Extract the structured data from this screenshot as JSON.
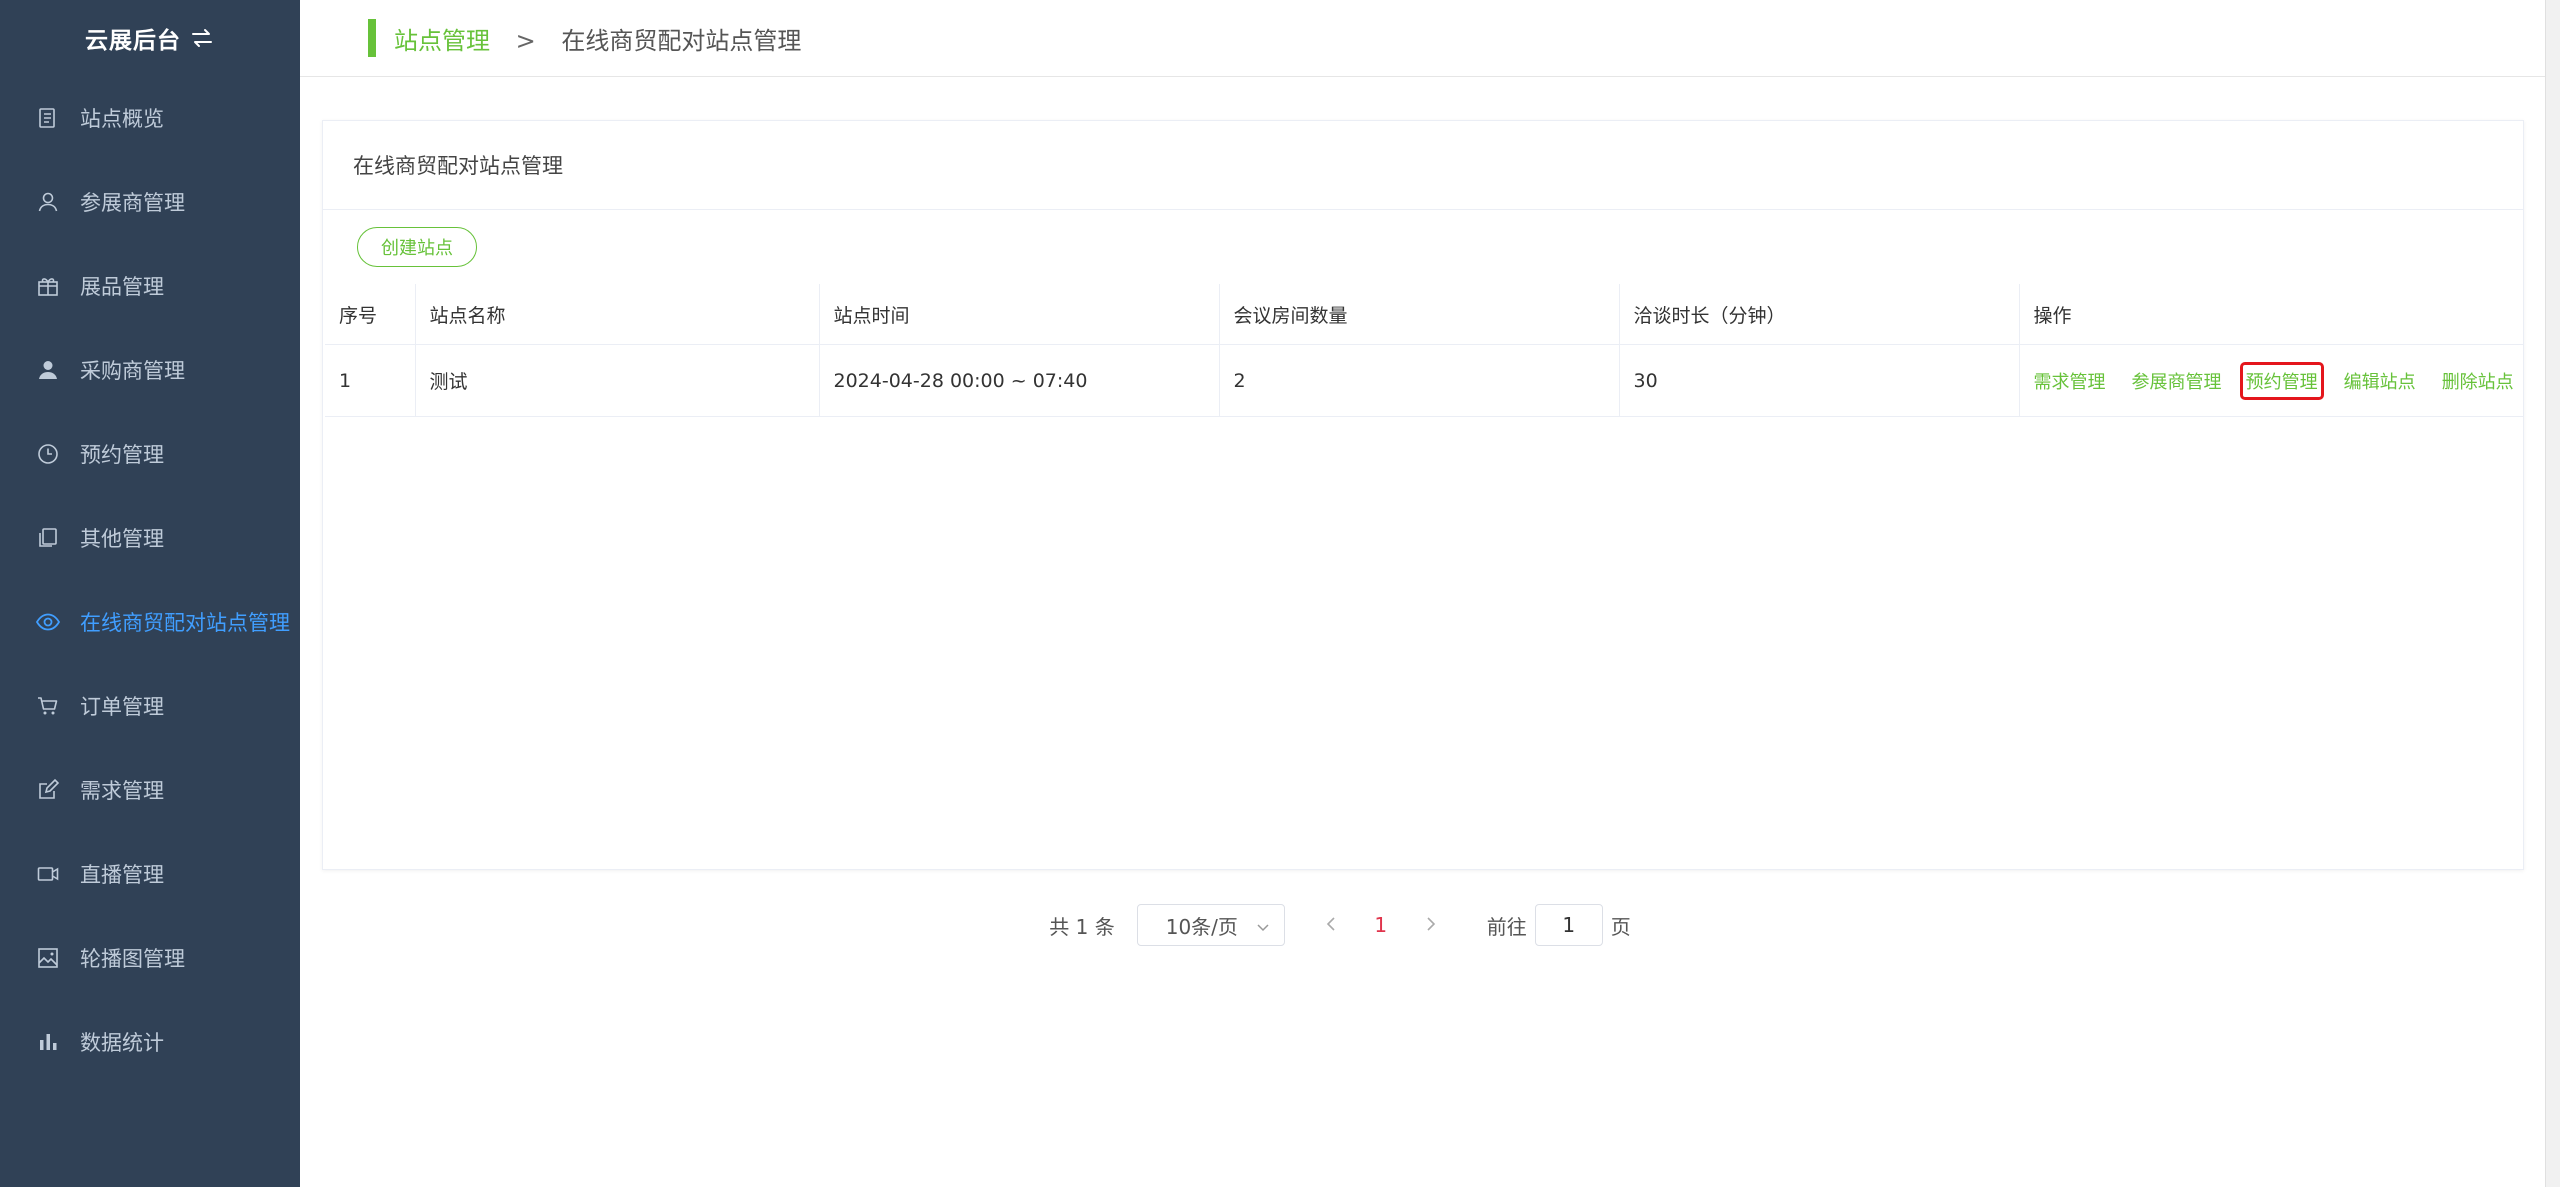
{
  "sidebar": {
    "brand": "云展后台",
    "items": [
      {
        "label": "站点概览",
        "icon": "document-icon"
      },
      {
        "label": "参展商管理",
        "icon": "user-icon"
      },
      {
        "label": "展品管理",
        "icon": "gift-icon"
      },
      {
        "label": "采购商管理",
        "icon": "person-icon"
      },
      {
        "label": "预约管理",
        "icon": "clock-icon"
      },
      {
        "label": "其他管理",
        "icon": "copy-icon"
      },
      {
        "label": "在线商贸配对站点管理",
        "icon": "eye-icon",
        "active": true
      },
      {
        "label": "订单管理",
        "icon": "cart-icon"
      },
      {
        "label": "需求管理",
        "icon": "edit-icon"
      },
      {
        "label": "直播管理",
        "icon": "video-icon"
      },
      {
        "label": "轮播图管理",
        "icon": "image-icon"
      },
      {
        "label": "数据统计",
        "icon": "bar-chart-icon"
      }
    ]
  },
  "breadcrumb": {
    "parent": "站点管理",
    "separator": ">",
    "current": "在线商贸配对站点管理"
  },
  "card": {
    "title": "在线商贸配对站点管理",
    "create_button": "创建站点"
  },
  "table": {
    "columns": [
      "序号",
      "站点名称",
      "站点时间",
      "会议房间数量",
      "洽谈时长（分钟）",
      "操作"
    ],
    "rows": [
      {
        "index": "1",
        "name": "测试",
        "time": "2024-04-28 00:00 ~ 07:40",
        "rooms": "2",
        "duration": "30",
        "actions": [
          "需求管理",
          "参展商管理",
          "预约管理",
          "编辑站点",
          "删除站点"
        ]
      }
    ]
  },
  "pagination": {
    "total": "共 1 条",
    "page_size": "10条/页",
    "current_page": "1",
    "goto_label": "前往",
    "goto_value": "1",
    "page_suffix": "页"
  },
  "colors": {
    "sidebar_bg": "#304156",
    "accent_green": "#67c23a",
    "active_blue": "#409eff",
    "highlight_red": "#e4161c"
  }
}
